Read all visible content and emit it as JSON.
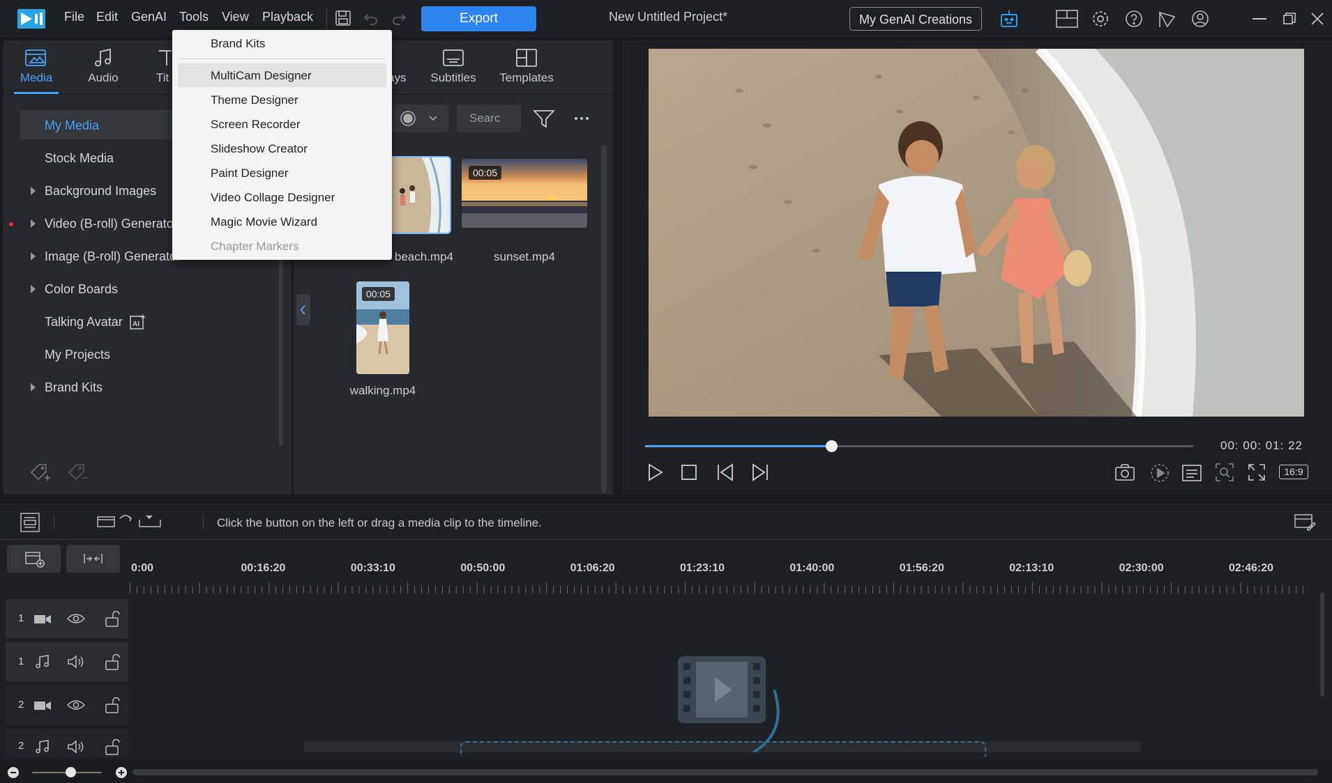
{
  "menu": {
    "file": "File",
    "edit": "Edit",
    "genai": "GenAI",
    "tools": "Tools",
    "view": "View",
    "playback": "Playback"
  },
  "toolbar": {
    "export_label": "Export",
    "project_title": "New Untitled Project*",
    "genai_creations": "My GenAI Creations"
  },
  "tabs": [
    "Media",
    "Audio",
    "Tit",
    "ays",
    "Subtitles",
    "Templates"
  ],
  "library": {
    "items": [
      "My Media",
      "Stock Media",
      "Background Images",
      "Video (B-roll) Generator",
      "Image (B-roll) Generator",
      "Color Boards",
      "Talking Avatar",
      "My Projects",
      "Brand Kits"
    ]
  },
  "media": {
    "search_placeholder": "Searc",
    "clips": [
      {
        "name": "couple-beach.mp4",
        "visible_name": "beach.mp4",
        "duration": ""
      },
      {
        "name": "sunset.mp4",
        "duration": "00:05"
      },
      {
        "name": "walking.mp4",
        "duration": "00:05"
      }
    ]
  },
  "tools_menu": {
    "items": [
      "Brand Kits",
      "MultiCam Designer",
      "Theme Designer",
      "Screen Recorder",
      "Slideshow Creator",
      "Paint Designer",
      "Video Collage Designer",
      "Magic Movie Wizard",
      "Chapter Markers"
    ],
    "highlighted": "MultiCam Designer",
    "disabled": "Chapter Markers"
  },
  "preview": {
    "timecode": "00: 00: 01: 22",
    "aspect_ratio": "16:9",
    "playback_progress": 0.34
  },
  "timeline": {
    "hint": "Click the button on the left or drag a media clip to the timeline.",
    "ruler": [
      "0:00",
      "00:16:20",
      "00:33:10",
      "00:50:00",
      "01:06:20",
      "01:23:10",
      "01:40:00",
      "01:56:20",
      "02:13:10",
      "02:30:00",
      "02:46:20"
    ],
    "tracks": [
      {
        "number": "1",
        "type": "video"
      },
      {
        "number": "1",
        "type": "audio"
      },
      {
        "number": "2",
        "type": "video"
      },
      {
        "number": "2",
        "type": "audio"
      }
    ],
    "zoom_level": 0.55
  },
  "colors": {
    "accent": "#2d83f0",
    "highlight_text": "#4aa3ff",
    "panel": "#28292c"
  }
}
